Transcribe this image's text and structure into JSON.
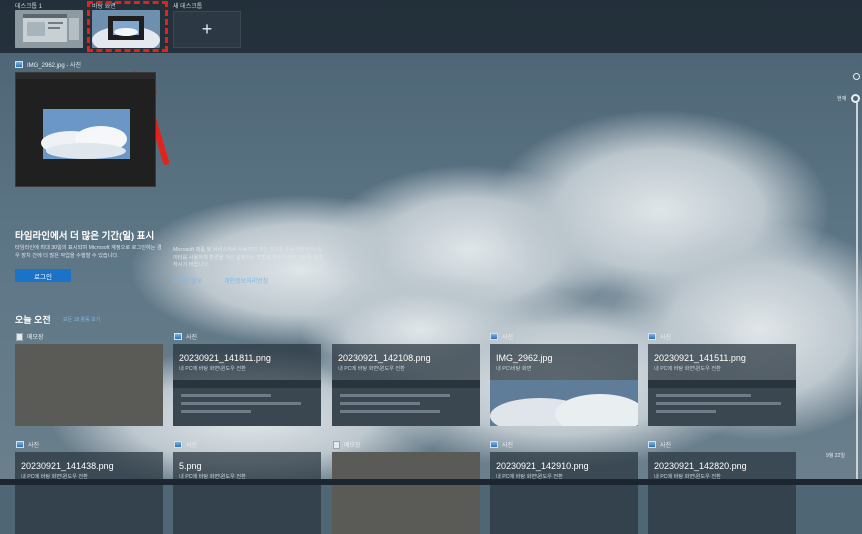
{
  "desktops": [
    {
      "label": "데스크톱 1"
    },
    {
      "label": "바탕 화면"
    },
    {
      "label": "새 데스크톱",
      "icon": "plus-icon"
    }
  ],
  "window": {
    "title": "IMG_2962.jpg - 사진",
    "icon": "photos-app-icon"
  },
  "promo": {
    "title": "타임라인에서 더 많은 기간(일) 표시",
    "description": "타임라인에 최대 30일의 표시되며 Microsoft 계정으로 로그인하는 경우 장치 간에 더 많은 작업을 수행할 수 있습니다.",
    "login_label": "로그인",
    "privacy_text": "Microsoft 제품 및 서비스에서 사용자의 개인 정보를 존중하면서 이 데이터를 사용하여 환경을 개선 설정하는 방법을 확인하려면 다음을 참조하시기 바랍니다.",
    "more_info_link": "자세한 정보",
    "privacy_link": "개인정보처리방침"
  },
  "section": {
    "title": "오늘 오전",
    "link": "모든 18 활동 보기"
  },
  "cards_row1": [
    {
      "app": "메모장",
      "icon": "notepad-icon",
      "title": "",
      "sub": ""
    },
    {
      "app": "사진",
      "icon": "photos-app-icon",
      "title": "20230921_141811.png",
      "sub": "내 PC에 바탕 화면\\윈도우 전환"
    },
    {
      "app": "",
      "icon": "",
      "title": "20230921_142108.png",
      "sub": "내 PC에 바탕 화면\\윈도우 전환"
    },
    {
      "app": "사진",
      "icon": "photos-app-icon",
      "title": "IMG_2962.jpg",
      "sub": "내 PC\\바탕 화면"
    },
    {
      "app": "사진",
      "icon": "photos-app-icon",
      "title": "20230921_141511.png",
      "sub": "내 PC에 바탕 화면\\윈도우 전환"
    }
  ],
  "cards_row2": [
    {
      "app": "사진",
      "icon": "photos-app-icon",
      "title": "20230921_141438.png",
      "sub": "내 PC에 바탕 화면\\윈도우 전환"
    },
    {
      "app": "사진",
      "icon": "photos-app-icon",
      "title": "5.png",
      "sub": "내 PC에 바탕 화면\\윈도우 전환"
    },
    {
      "app": "메모장",
      "icon": "notepad-icon",
      "title": "",
      "sub": ""
    },
    {
      "app": "사진",
      "icon": "photos-app-icon",
      "title": "20230921_142910.png",
      "sub": "내 PC에 바탕 화면\\윈도우 전환"
    },
    {
      "app": "사진",
      "icon": "photos-app-icon",
      "title": "20230921_142820.png",
      "sub": "내 PC에 바탕 화면\\윈도우 전환"
    }
  ],
  "timeline": {
    "now_label": "현재",
    "date_label": "9월 22일"
  },
  "colors": {
    "selection": "#e2231a",
    "link": "#7cb8ee",
    "button": "#1a73c8"
  }
}
